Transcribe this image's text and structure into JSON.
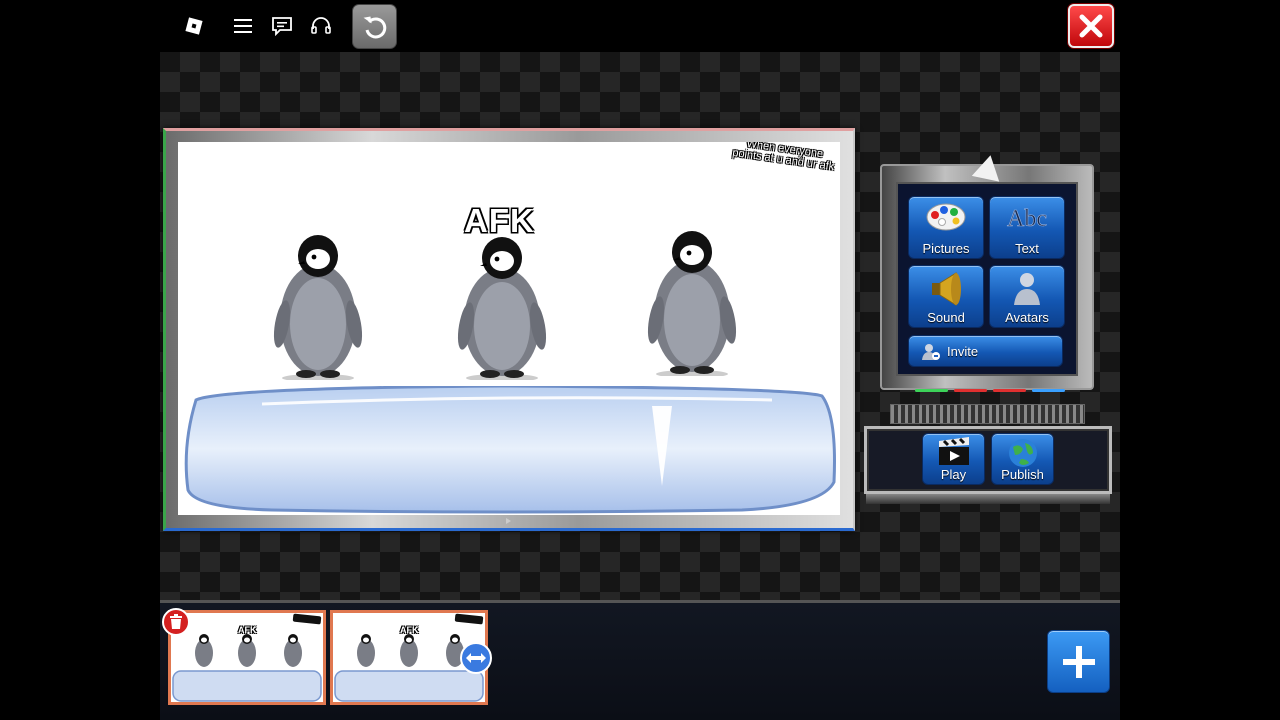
{
  "colors": {
    "accent": "#1458b4",
    "close": "#e01b1b",
    "frame_orange": "#e07850"
  },
  "topbar": {
    "icons": [
      "roblox-logo-icon",
      "menu-icon",
      "chat-icon",
      "headset-icon"
    ],
    "undo_icon": "undo-icon",
    "close_icon": "close-icon"
  },
  "stage": {
    "title": "AFK",
    "caption": "When everyone points at u and ur afk"
  },
  "tools": {
    "pictures": "Pictures",
    "text": "Text",
    "sound": "Sound",
    "avatars": "Avatars",
    "invite": "Invite"
  },
  "playbar": {
    "play": "Play",
    "publish": "Publish"
  },
  "filmstrip": {
    "frames": [
      {
        "title": "AFK"
      },
      {
        "title": "AFK"
      }
    ],
    "add_icon": "plus-icon",
    "delete_icon": "trash-icon",
    "swap_icon": "swap-arrows-icon"
  }
}
